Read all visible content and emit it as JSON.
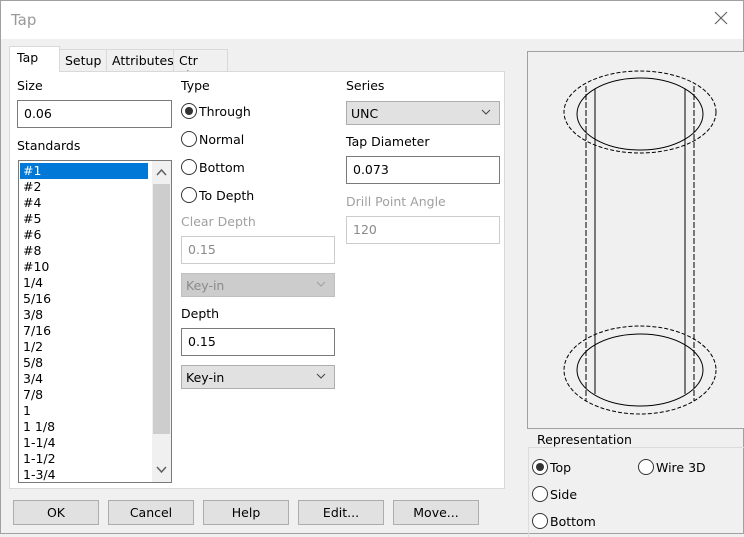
{
  "window": {
    "title": "Tap",
    "close_icon": "close-icon"
  },
  "tabs": [
    {
      "label": "Tap",
      "active": true
    },
    {
      "label": "Setup",
      "active": false
    },
    {
      "label": "Attributes",
      "active": false
    },
    {
      "label": "Ctr Line",
      "active": false
    }
  ],
  "size": {
    "label": "Size",
    "value": "0.06"
  },
  "standards": {
    "label": "Standards",
    "selected": "#1",
    "items": [
      "#1",
      "#2",
      "#4",
      "#5",
      "#6",
      "#8",
      "#10",
      "1/4",
      "5/16",
      "3/8",
      "7/16",
      "1/2",
      "5/8",
      "3/4",
      "7/8",
      "1",
      "1 1/8",
      "1-1/4",
      "1-1/2",
      "1-3/4"
    ]
  },
  "type": {
    "label": "Type",
    "options": [
      {
        "label": "Through",
        "selected": true
      },
      {
        "label": "Normal",
        "selected": false
      },
      {
        "label": "Bottom",
        "selected": false
      },
      {
        "label": "To Depth",
        "selected": false
      }
    ]
  },
  "clear_depth": {
    "label": "Clear Depth",
    "value": "0.15",
    "mode": "Key-in",
    "disabled": true
  },
  "depth": {
    "label": "Depth",
    "value": "0.15",
    "mode": "Key-in"
  },
  "series": {
    "label": "Series",
    "value": "UNC"
  },
  "tap_diameter": {
    "label": "Tap Diameter",
    "value": "0.073"
  },
  "drill_point_angle": {
    "label": "Drill Point Angle",
    "value": "120",
    "disabled": true
  },
  "representation": {
    "label": "Representation",
    "options": [
      {
        "label": "Top",
        "selected": true
      },
      {
        "label": "Wire 3D",
        "selected": false
      },
      {
        "label": "Side",
        "selected": false
      },
      {
        "label": "Bottom",
        "selected": false
      }
    ]
  },
  "buttons": {
    "ok": "OK",
    "cancel": "Cancel",
    "help": "Help",
    "edit": "Edit...",
    "move": "Move..."
  }
}
